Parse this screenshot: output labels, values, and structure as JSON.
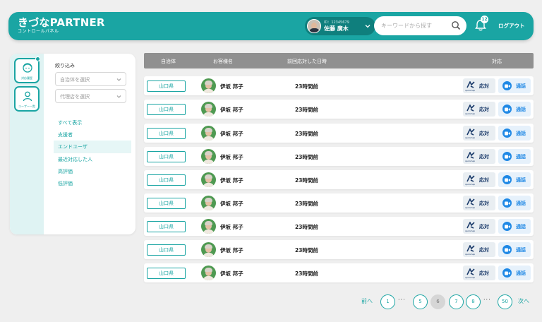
{
  "header": {
    "brand_title": "きづなPARTNER",
    "brand_subtitle": "コントロールパネル",
    "user_id": "ID：12345679",
    "user_name": "佐藤 廣木",
    "search_placeholder": "キーワードから探す",
    "notification_count": "12",
    "logout_label": "ログアウト"
  },
  "sidebar": {
    "rail": [
      {
        "label": "対応履歴",
        "icon": "face-icon"
      },
      {
        "label": "ユーザー一覧",
        "icon": "user-icon"
      }
    ],
    "filter_title": "絞り込み",
    "select_municipality": "自治体を選択",
    "select_agency": "代理店を選択",
    "filters": [
      "すべて表示",
      "支援者",
      "エンドユーザ",
      "最近対応した人",
      "高評価",
      "低評価"
    ],
    "active_filter": "エンドユーザ"
  },
  "table": {
    "headers": {
      "municipality": "自治体",
      "customer": "お客様名",
      "last_response": "前回応対した日時",
      "action": "対応"
    },
    "rows": [
      {
        "municipality": "山口県",
        "customer": "伊坂 邦子",
        "last_response": "23時間前"
      },
      {
        "municipality": "山口県",
        "customer": "伊坂 邦子",
        "last_response": "23時間前"
      },
      {
        "municipality": "山口県",
        "customer": "伊坂 邦子",
        "last_response": "23時間前"
      },
      {
        "municipality": "山口県",
        "customer": "伊坂 邦子",
        "last_response": "23時間前"
      },
      {
        "municipality": "山口県",
        "customer": "伊坂 邦子",
        "last_response": "23時間前"
      },
      {
        "municipality": "山口県",
        "customer": "伊坂 邦子",
        "last_response": "23時間前"
      },
      {
        "municipality": "山口県",
        "customer": "伊坂 邦子",
        "last_response": "23時間前"
      },
      {
        "municipality": "山口県",
        "customer": "伊坂 邦子",
        "last_response": "23時間前"
      },
      {
        "municipality": "山口県",
        "customer": "伊坂 邦子",
        "last_response": "23時間前"
      }
    ],
    "respond_label": "応対",
    "respond_brand": "qanomap",
    "call_label": "通話"
  },
  "pagination": {
    "prev": "前へ",
    "next": "次へ",
    "pages": [
      "1",
      "5",
      "6",
      "7",
      "8",
      "50"
    ],
    "current": "6",
    "ellipsis": "···"
  },
  "colors": {
    "accent": "#1aa5a3",
    "call_blue": "#1e88e5",
    "header_row": "#909090"
  }
}
